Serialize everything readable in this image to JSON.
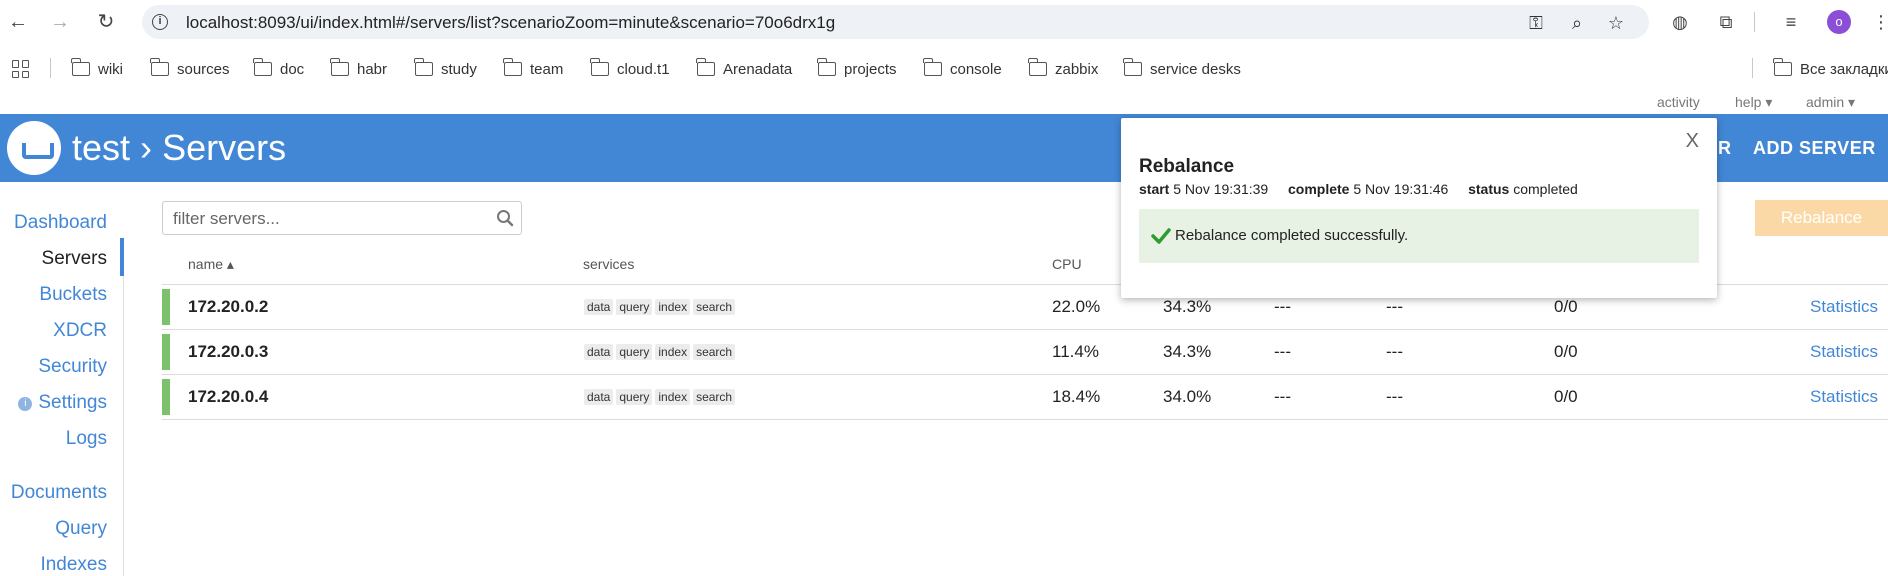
{
  "browser": {
    "url": "localhost:8093/ui/index.html#/servers/list?scenarioZoom=minute&scenario=70o6drx1g",
    "profile_initial": "o",
    "bookmarks": [
      "wiki",
      "sources",
      "doc",
      "habr",
      "study",
      "team",
      "cloud.t1",
      "Arenadata",
      "projects",
      "console",
      "zabbix",
      "service desks"
    ],
    "all_bookmarks": "Все закладки"
  },
  "toplinks": {
    "activity": "activity",
    "help": "help ▾",
    "admin": "admin ▾"
  },
  "header": {
    "bucket": "test",
    "chevron": "›",
    "section": "Servers",
    "partial_button": "R",
    "add_server": "ADD SERVER"
  },
  "sidebar": {
    "items": [
      "Dashboard",
      "Servers",
      "Buckets",
      "XDCR",
      "Security",
      "Settings",
      "Logs",
      "Documents",
      "Query",
      "Indexes"
    ],
    "active": "Servers"
  },
  "filter": {
    "placeholder": "filter servers..."
  },
  "rebalance_button": "Rebalance",
  "table": {
    "headers": {
      "name": "name ▴",
      "services": "services",
      "cpu": "CPU"
    },
    "rows": [
      {
        "name": "172.20.0.2",
        "services": [
          "data",
          "query",
          "index",
          "search"
        ],
        "cpu": "22.0%",
        "ram": "34.3%",
        "c3": "---",
        "c4": "---",
        "c5": "0/0",
        "action": "Statistics"
      },
      {
        "name": "172.20.0.3",
        "services": [
          "data",
          "query",
          "index",
          "search"
        ],
        "cpu": "11.4%",
        "ram": "34.3%",
        "c3": "---",
        "c4": "---",
        "c5": "0/0",
        "action": "Statistics"
      },
      {
        "name": "172.20.0.4",
        "services": [
          "data",
          "query",
          "index",
          "search"
        ],
        "cpu": "18.4%",
        "ram": "34.0%",
        "c3": "---",
        "c4": "---",
        "c5": "0/0",
        "action": "Statistics"
      }
    ]
  },
  "popup": {
    "close": "X",
    "title": "Rebalance",
    "start_label": "start",
    "start_value": "5 Nov 19:31:39",
    "complete_label": "complete",
    "complete_value": "5 Nov 19:31:46",
    "status_label": "status",
    "status_value": "completed",
    "message": "Rebalance completed successfully."
  },
  "colors": {
    "brand": "#4287d6",
    "healthy": "#7cc26c",
    "success_bg": "#e7f2e4",
    "rebalance_disabled": "#fbd9a6"
  }
}
